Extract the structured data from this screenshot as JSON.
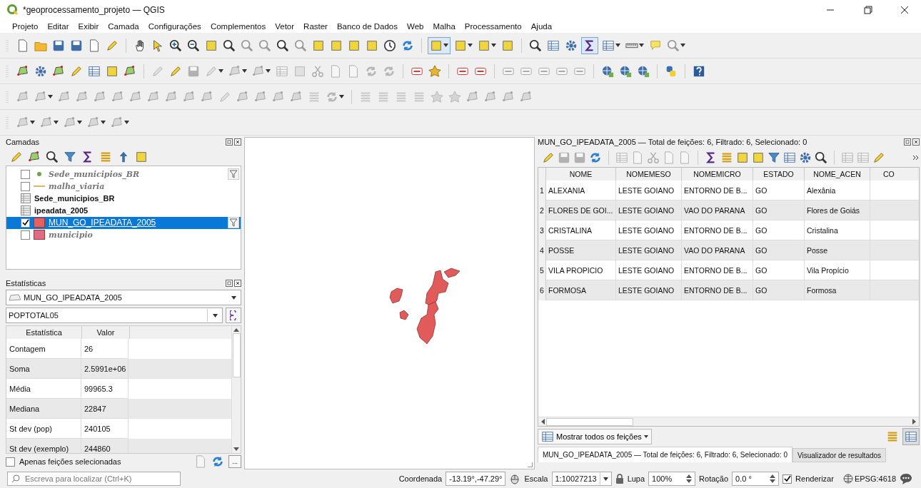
{
  "window": {
    "title": "*geoprocessamento_projeto — QGIS"
  },
  "menu": [
    "Projeto",
    "Editar",
    "Exibir",
    "Camada",
    "Configurações",
    "Complementos",
    "Vetor",
    "Raster",
    "Banco de Dados",
    "Web",
    "Malha",
    "Processamento",
    "Ajuda"
  ],
  "layers_panel": {
    "title": "Camadas",
    "layers": [
      {
        "name": "Sede_municipios_BR",
        "kind": "point",
        "checked": false,
        "selected": false,
        "filtered": true,
        "color": "#6fa04d"
      },
      {
        "name": "malha_viaria",
        "kind": "line",
        "checked": false,
        "selected": false,
        "filtered": false,
        "color": "#d9b85f"
      },
      {
        "name": "Sede_municipios_BR",
        "kind": "table",
        "selected": false,
        "filtered": false
      },
      {
        "name": "ipeadata_2005",
        "kind": "table",
        "selected": false,
        "filtered": false
      },
      {
        "name": "MUN_GO_IPEADATA_2005",
        "kind": "polygon",
        "checked": true,
        "selected": true,
        "filtered": true,
        "color": "#e8605e"
      },
      {
        "name": "municipio",
        "kind": "polygon",
        "checked": false,
        "selected": false,
        "filtered": false,
        "color": "#e06b86"
      }
    ]
  },
  "statistics_panel": {
    "title": "Estatísticas",
    "layer": "MUN_GO_IPEADATA_2005",
    "field": "POPTOTAL05",
    "columns": [
      "Estatística",
      "Valor"
    ],
    "rows": [
      {
        "statistic": "Contagem",
        "value": "26"
      },
      {
        "statistic": "Soma",
        "value": "2.5991e+06"
      },
      {
        "statistic": "Média",
        "value": "99965.3"
      },
      {
        "statistic": "Mediana",
        "value": "22847"
      },
      {
        "statistic": "St dev (pop)",
        "value": "240105"
      },
      {
        "statistic": "St dev (exemplo)",
        "value": "244860"
      }
    ],
    "selected_only": {
      "label": "Apenas feições selecionadas",
      "checked": false
    },
    "more_button": "..."
  },
  "attribute_table": {
    "title": "MUN_GO_IPEADATA_2005 — Total de feições: 6, Filtrado: 6, Selecionado: 0",
    "columns": [
      "NOME",
      "NOMEMESO",
      "NOMEMICRO",
      "ESTADO",
      "NOME_ACEN",
      "CO"
    ],
    "rows": [
      {
        "number": "1",
        "cells": [
          "ALEXANIA",
          "LESTE GOIANO",
          "ENTORNO DE B...",
          "GO",
          "Alexânia"
        ]
      },
      {
        "number": "2",
        "cells": [
          "FLORES DE GOI...",
          "LESTE GOIANO",
          "VAO DO PARANA",
          "GO",
          "Flores de Goiás"
        ]
      },
      {
        "number": "3",
        "cells": [
          "CRISTALINA",
          "LESTE GOIANO",
          "ENTORNO DE B...",
          "GO",
          "Cristalina"
        ]
      },
      {
        "number": "4",
        "cells": [
          "POSSE",
          "LESTE GOIANO",
          "VAO DO PARANA",
          "GO",
          "Posse"
        ]
      },
      {
        "number": "5",
        "cells": [
          "VILA PROPICIO",
          "LESTE GOIANO",
          "ENTORNO DE B...",
          "GO",
          "Vila Propício"
        ]
      },
      {
        "number": "6",
        "cells": [
          "FORMOSA",
          "LESTE GOIANO",
          "ENTORNO DE B...",
          "GO",
          "Formosa"
        ]
      }
    ],
    "filter_button": "Mostrar todos os feições",
    "tabs": [
      {
        "label": "MUN_GO_IPEADATA_2005 — Total de feições: 6, Filtrado: 6, Selecionado: 0",
        "selected": true
      },
      {
        "label": "Visualizador de resultados",
        "selected": false
      }
    ]
  },
  "status_bar": {
    "search_placeholder": "Escreva para localizar (Ctrl+K)",
    "coordinate_label": "Coordenada",
    "coordinate": "-13.19°,-47.29°",
    "scale_label": "Escala",
    "scale": "1:10027213",
    "magnifier_label": "Lupa",
    "magnifier": "100%",
    "rotation_label": "Rotação",
    "rotation": "0.0 °",
    "render": {
      "label": "Renderizar",
      "checked": true
    },
    "crs": "EPSG:4618"
  }
}
